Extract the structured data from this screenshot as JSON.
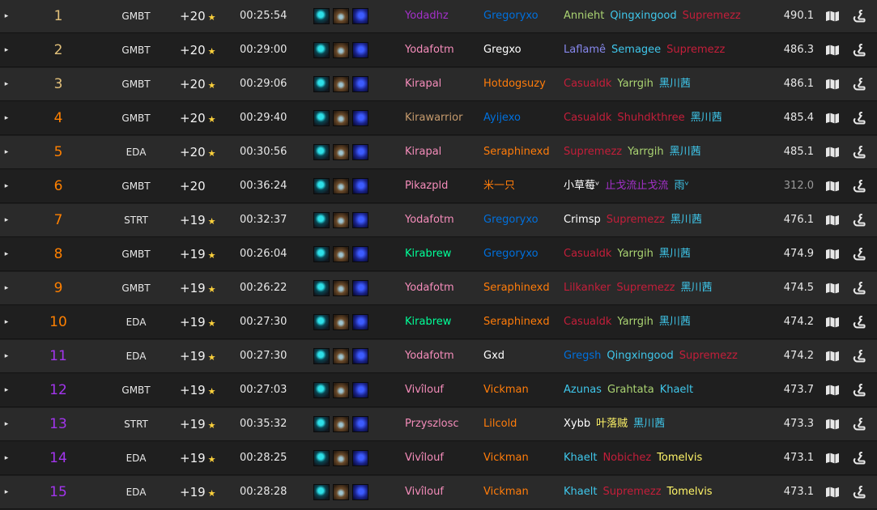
{
  "icons": {
    "expand": "▸",
    "star": "★",
    "map": "map-icon",
    "link": "link-icon"
  },
  "colors": {
    "rank_orange": "#ff8000",
    "rank_top": "#e2c07a",
    "rank_purple": "#a335ee",
    "star": "#ffd23c",
    "druid": "#ff7c0a",
    "paladin": "#f48cba",
    "monk": "#00ff98",
    "mage": "#3fc7eb",
    "shaman": "#0070dd",
    "hunter": "#aad372",
    "rogue": "#fff468",
    "dk": "#c41e3a",
    "warrior": "#c69b6d",
    "demonhunter": "#a330c9",
    "priest": "#ffffff"
  },
  "rows": [
    {
      "rank": "1",
      "rank_color": "#e2c07a",
      "affix": "GMBT",
      "level": "+20",
      "starred": true,
      "time": "00:25:54",
      "tank": {
        "name": "Yodadhz",
        "color": "#a330c9"
      },
      "healer": {
        "name": "Gregoryxo",
        "color": "#0070dd"
      },
      "dps": [
        {
          "name": "Annieht",
          "color": "#aad372"
        },
        {
          "name": "Qingxingood",
          "color": "#3fc7eb"
        },
        {
          "name": "Supremezz",
          "color": "#c41e3a"
        }
      ],
      "score": "490.1",
      "score_dim": false
    },
    {
      "rank": "2",
      "rank_color": "#e2c07a",
      "affix": "GMBT",
      "level": "+20",
      "starred": true,
      "time": "00:29:00",
      "tank": {
        "name": "Yodafotm",
        "color": "#f48cba"
      },
      "healer": {
        "name": "Gregxo",
        "color": "#ffffff"
      },
      "dps": [
        {
          "name": "Laflamê",
          "color": "#8788ee"
        },
        {
          "name": "Semagee",
          "color": "#3fc7eb"
        },
        {
          "name": "Supremezz",
          "color": "#c41e3a"
        }
      ],
      "score": "486.3",
      "score_dim": false
    },
    {
      "rank": "3",
      "rank_color": "#e2c07a",
      "affix": "GMBT",
      "level": "+20",
      "starred": true,
      "time": "00:29:06",
      "tank": {
        "name": "Kirapal",
        "color": "#f48cba"
      },
      "healer": {
        "name": "Hotdogsuzy",
        "color": "#ff7c0a"
      },
      "dps": [
        {
          "name": "Casualdk",
          "color": "#c41e3a"
        },
        {
          "name": "Yarrgih",
          "color": "#aad372"
        },
        {
          "name": "黑川茜",
          "color": "#3fc7eb"
        }
      ],
      "score": "486.1",
      "score_dim": false
    },
    {
      "rank": "4",
      "rank_color": "#ff8000",
      "affix": "GMBT",
      "level": "+20",
      "starred": true,
      "time": "00:29:40",
      "tank": {
        "name": "Kirawarrior",
        "color": "#c69b6d"
      },
      "healer": {
        "name": "Ayijexo",
        "color": "#0070dd"
      },
      "dps": [
        {
          "name": "Casualdk",
          "color": "#c41e3a"
        },
        {
          "name": "Shuhdkthree",
          "color": "#c41e3a"
        },
        {
          "name": "黑川茜",
          "color": "#3fc7eb"
        }
      ],
      "score": "485.4",
      "score_dim": false
    },
    {
      "rank": "5",
      "rank_color": "#ff8000",
      "affix": "EDA",
      "level": "+20",
      "starred": true,
      "time": "00:30:56",
      "tank": {
        "name": "Kirapal",
        "color": "#f48cba"
      },
      "healer": {
        "name": "Seraphinexd",
        "color": "#ff7c0a"
      },
      "dps": [
        {
          "name": "Supremezz",
          "color": "#c41e3a"
        },
        {
          "name": "Yarrgih",
          "color": "#aad372"
        },
        {
          "name": "黑川茜",
          "color": "#3fc7eb"
        }
      ],
      "score": "485.1",
      "score_dim": false
    },
    {
      "rank": "6",
      "rank_color": "#ff8000",
      "affix": "GMBT",
      "level": "+20",
      "starred": false,
      "time": "00:36:24",
      "tank": {
        "name": "Pikazpld",
        "color": "#f48cba"
      },
      "healer": {
        "name": "米一只",
        "color": "#ff7c0a"
      },
      "dps": [
        {
          "name": "小草莓ᵛ",
          "color": "#ffffff"
        },
        {
          "name": "止戈流止戈流",
          "color": "#a330c9"
        },
        {
          "name": "雨ᵛ",
          "color": "#3fc7eb"
        }
      ],
      "score": "312.0",
      "score_dim": true
    },
    {
      "rank": "7",
      "rank_color": "#ff8000",
      "affix": "STRT",
      "level": "+19",
      "starred": true,
      "time": "00:32:37",
      "tank": {
        "name": "Yodafotm",
        "color": "#f48cba"
      },
      "healer": {
        "name": "Gregoryxo",
        "color": "#0070dd"
      },
      "dps": [
        {
          "name": "Crimsp",
          "color": "#ffffff"
        },
        {
          "name": "Supremezz",
          "color": "#c41e3a"
        },
        {
          "name": "黑川茜",
          "color": "#3fc7eb"
        }
      ],
      "score": "476.1",
      "score_dim": false
    },
    {
      "rank": "8",
      "rank_color": "#ff8000",
      "affix": "GMBT",
      "level": "+19",
      "starred": true,
      "time": "00:26:04",
      "tank": {
        "name": "Kirabrew",
        "color": "#00ff98"
      },
      "healer": {
        "name": "Gregoryxo",
        "color": "#0070dd"
      },
      "dps": [
        {
          "name": "Casualdk",
          "color": "#c41e3a"
        },
        {
          "name": "Yarrgih",
          "color": "#aad372"
        },
        {
          "name": "黑川茜",
          "color": "#3fc7eb"
        }
      ],
      "score": "474.9",
      "score_dim": false
    },
    {
      "rank": "9",
      "rank_color": "#ff8000",
      "affix": "GMBT",
      "level": "+19",
      "starred": true,
      "time": "00:26:22",
      "tank": {
        "name": "Yodafotm",
        "color": "#f48cba"
      },
      "healer": {
        "name": "Seraphinexd",
        "color": "#ff7c0a"
      },
      "dps": [
        {
          "name": "Lilkanker",
          "color": "#c41e3a"
        },
        {
          "name": "Supremezz",
          "color": "#c41e3a"
        },
        {
          "name": "黑川茜",
          "color": "#3fc7eb"
        }
      ],
      "score": "474.5",
      "score_dim": false
    },
    {
      "rank": "10",
      "rank_color": "#ff8000",
      "affix": "EDA",
      "level": "+19",
      "starred": true,
      "time": "00:27:30",
      "tank": {
        "name": "Kirabrew",
        "color": "#00ff98"
      },
      "healer": {
        "name": "Seraphinexd",
        "color": "#ff7c0a"
      },
      "dps": [
        {
          "name": "Casualdk",
          "color": "#c41e3a"
        },
        {
          "name": "Yarrgih",
          "color": "#aad372"
        },
        {
          "name": "黑川茜",
          "color": "#3fc7eb"
        }
      ],
      "score": "474.2",
      "score_dim": false
    },
    {
      "rank": "11",
      "rank_color": "#a335ee",
      "affix": "EDA",
      "level": "+19",
      "starred": true,
      "time": "00:27:30",
      "tank": {
        "name": "Yodafotm",
        "color": "#f48cba"
      },
      "healer": {
        "name": "Gxd",
        "color": "#ffffff"
      },
      "dps": [
        {
          "name": "Gregsh",
          "color": "#0070dd"
        },
        {
          "name": "Qingxingood",
          "color": "#3fc7eb"
        },
        {
          "name": "Supremezz",
          "color": "#c41e3a"
        }
      ],
      "score": "474.2",
      "score_dim": false
    },
    {
      "rank": "12",
      "rank_color": "#a335ee",
      "affix": "GMBT",
      "level": "+19",
      "starred": true,
      "time": "00:27:03",
      "tank": {
        "name": "Vivîlouf",
        "color": "#f48cba"
      },
      "healer": {
        "name": "Vickman",
        "color": "#ff7c0a"
      },
      "dps": [
        {
          "name": "Azunas",
          "color": "#3fc7eb"
        },
        {
          "name": "Grahtata",
          "color": "#aad372"
        },
        {
          "name": "Khaelt",
          "color": "#3fc7eb"
        }
      ],
      "score": "473.7",
      "score_dim": false
    },
    {
      "rank": "13",
      "rank_color": "#a335ee",
      "affix": "STRT",
      "level": "+19",
      "starred": true,
      "time": "00:35:32",
      "tank": {
        "name": "Przyszlosc",
        "color": "#f48cba"
      },
      "healer": {
        "name": "Lilcold",
        "color": "#ff7c0a"
      },
      "dps": [
        {
          "name": "Xybb",
          "color": "#ffffff"
        },
        {
          "name": "叶落贼",
          "color": "#fff468"
        },
        {
          "name": "黑川茜",
          "color": "#3fc7eb"
        }
      ],
      "score": "473.3",
      "score_dim": false
    },
    {
      "rank": "14",
      "rank_color": "#a335ee",
      "affix": "EDA",
      "level": "+19",
      "starred": true,
      "time": "00:28:25",
      "tank": {
        "name": "Vivîlouf",
        "color": "#f48cba"
      },
      "healer": {
        "name": "Vickman",
        "color": "#ff7c0a"
      },
      "dps": [
        {
          "name": "Khaelt",
          "color": "#3fc7eb"
        },
        {
          "name": "Nobichez",
          "color": "#c41e3a"
        },
        {
          "name": "Tomelvis",
          "color": "#fff468"
        }
      ],
      "score": "473.1",
      "score_dim": false
    },
    {
      "rank": "15",
      "rank_color": "#a335ee",
      "affix": "EDA",
      "level": "+19",
      "starred": true,
      "time": "00:28:28",
      "tank": {
        "name": "Vivîlouf",
        "color": "#f48cba"
      },
      "healer": {
        "name": "Vickman",
        "color": "#ff7c0a"
      },
      "dps": [
        {
          "name": "Khaelt",
          "color": "#3fc7eb"
        },
        {
          "name": "Supremezz",
          "color": "#c41e3a"
        },
        {
          "name": "Tomelvis",
          "color": "#fff468"
        }
      ],
      "score": "473.1",
      "score_dim": false
    }
  ]
}
